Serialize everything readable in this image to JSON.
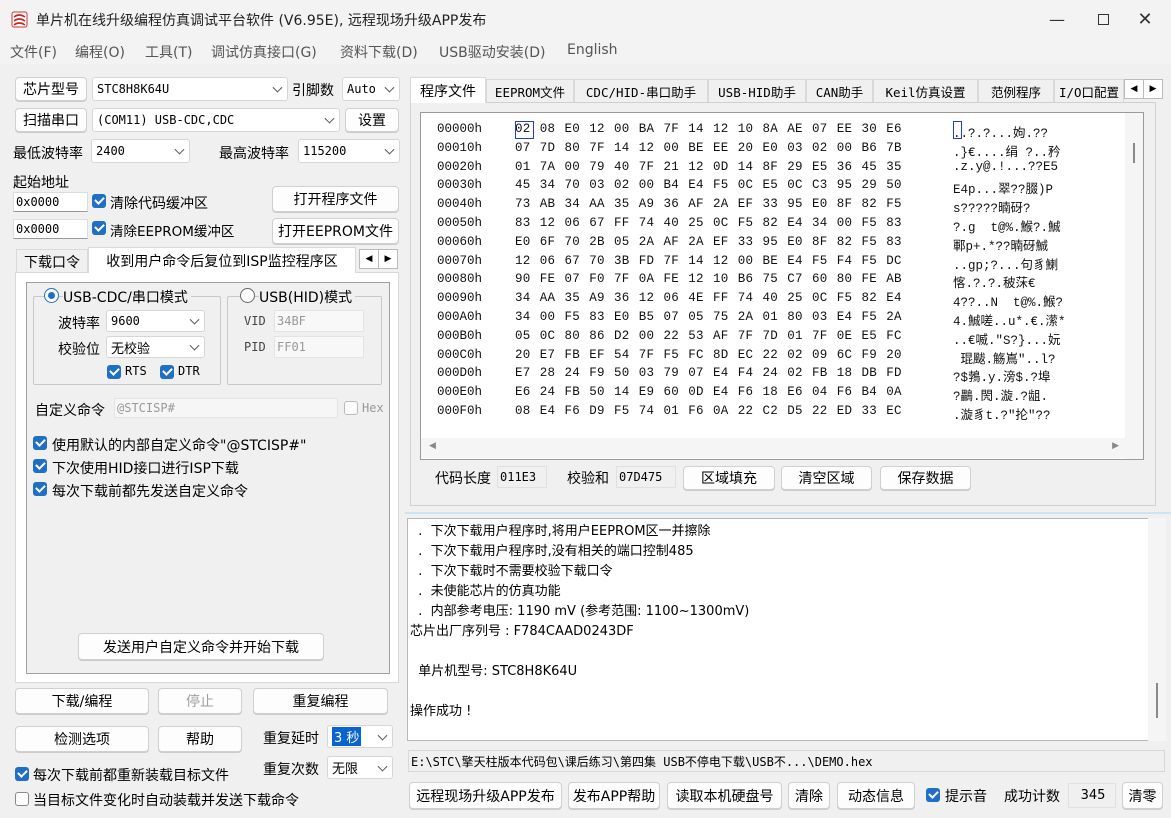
{
  "window": {
    "title": "单片机在线升级编程仿真调试平台软件 (V6.95E), 远程现场升级APP发布"
  },
  "menu": [
    "文件(F)",
    "编程(O)",
    "工具(T)",
    "调试仿真接口(G)",
    "资料下载(D)",
    "USB驱动安装(D)",
    "English"
  ],
  "left": {
    "chip_button": "芯片型号",
    "chip_value": "STC8H8K64U",
    "pins_label": "引脚数",
    "pins_value": "Auto",
    "scan_button": "扫描串口",
    "port_value": "(COM11) USB-CDC,CDC",
    "settings_button": "设置",
    "min_baud_label": "最低波特率",
    "min_baud_value": "2400",
    "max_baud_label": "最高波特率",
    "max_baud_value": "115200",
    "start_addr_label": "起始地址",
    "code_addr": "0x0000",
    "eeprom_addr": "0x0000",
    "clear_code_label": "清除代码缓冲区",
    "clear_eeprom_label": "清除EEPROM缓冲区",
    "open_program_button": "打开程序文件",
    "open_eeprom_button": "打开EEPROM文件",
    "tabs": [
      "下载口令",
      "收到用户命令后复位到ISP监控程序区"
    ],
    "mode_cdc": "USB-CDC/串口模式",
    "mode_hid": "USB(HID)模式",
    "baud_label": "波特率",
    "baud_value": "9600",
    "parity_label": "校验位",
    "parity_value": "无校验",
    "rts": "RTS",
    "dtr": "DTR",
    "vid_label": "VID",
    "vid_value": "34BF",
    "pid_label": "PID",
    "pid_value": "FF01",
    "custom_cmd_label": "自定义命令",
    "custom_cmd_placeholder": "@STCISP#",
    "hex_label": "Hex",
    "options": [
      "使用默认的内部自定义命令\"@STCISP#\"",
      "下次使用HID接口进行ISP下载",
      "每次下载前都先发送自定义命令"
    ],
    "send_button": "发送用户自定义命令并开始下载",
    "download_button": "下载/编程",
    "stop_button": "停止",
    "repeat_button": "重复编程",
    "detect_button": "检测选项",
    "help_button": "帮助",
    "repeat_delay_label": "重复延时",
    "repeat_delay_value": "3 秒",
    "repeat_count_label": "重复次数",
    "repeat_count_value": "无限",
    "reload_label": "每次下载前都重新装载目标文件",
    "auto_label": "当目标文件变化时自动装载并发送下载命令"
  },
  "right": {
    "tabs": [
      "程序文件",
      "EEPROM文件",
      "CDC/HID-串口助手",
      "USB-HID助手",
      "CAN助手",
      "Keil仿真设置",
      "范例程序",
      "I/O口配置"
    ],
    "hex_rows": [
      {
        "addr": "00000h",
        "bytes": "02 08 E0 12 00 BA 7F 14 12 10 8A AE 07 EE 30 E6",
        "ascii": "..?.?...姁.??"
      },
      {
        "addr": "00010h",
        "bytes": "07 7D 80 7F 14 12 00 BE EE 20 E0 03 02 00 B6 7B",
        "ascii": ".}€....绢 ?..矜"
      },
      {
        "addr": "00020h",
        "bytes": "01 7A 00 79 40 7F 21 12 0D 14 8F 29 E5 36 45 35",
        "ascii": ".z.y@.!...??E5"
      },
      {
        "addr": "00030h",
        "bytes": "45 34 70 03 02 00 B4 E4 F5 0C E5 0C C3 95 29 50",
        "ascii": "E4p...翠??腏)P"
      },
      {
        "addr": "00040h",
        "bytes": "73 AB 34 AA 35 A9 36 AF 2A EF 33 95 E0 8F 82 F5",
        "ascii": "s?????暔砑?"
      },
      {
        "addr": "00050h",
        "bytes": "83 12 06 67 FF 74 40 25 0C F5 82 E4 34 00 F5 83",
        "ascii": "?.g  t@%.鯸?.鯎"
      },
      {
        "addr": "00060h",
        "bytes": "E0 6F 70 2B 05 2A AF 2A EF 33 95 E0 8F 82 F5 83",
        "ascii": "鄆p+.*??暔砑鯎"
      },
      {
        "addr": "00070h",
        "bytes": "12 06 67 70 3B FD 7F 14 12 00 BE E4 F5 F4 F5 DC",
        "ascii": "..gp;?...句豸鯻"
      },
      {
        "addr": "00080h",
        "bytes": "90 FE 07 F0 7F 0A FE 12 10 B6 75 C7 60 80 FE AB",
        "ascii": "愘.?.?.秛莯€"
      },
      {
        "addr": "00090h",
        "bytes": "34 AA 35 A9 36 12 06 4E FF 74 40 25 0C F5 82 E4",
        "ascii": "4??..N  t@%.鯸?"
      },
      {
        "addr": "000A0h",
        "bytes": "34 00 F5 83 E0 B5 07 05 75 2A 01 80 03 E4 F5 2A",
        "ascii": "4.鯎嗟..u*.€.潆*"
      },
      {
        "addr": "000B0h",
        "bytes": "05 0C 80 86 D2 00 22 53 AF 7F 7D 01 7F 0E E5 FC",
        "ascii": "..€喴.\"S?}...妧"
      },
      {
        "addr": "000C0h",
        "bytes": "20 E7 FB EF 54 7F F5 FC 8D EC 22 02 09 6C F9 20",
        "ascii": " 琨颰.觞嶌\"..l?"
      },
      {
        "addr": "000D0h",
        "bytes": "E7 28 24 F9 50 03 79 07 E4 F4 24 02 FB 18 DB FD",
        "ascii": "?$鵓.y.滂$.?埠"
      },
      {
        "addr": "000E0h",
        "bytes": "E6 24 FB 50 14 E9 60 0D E4 F6 18 E6 04 F6 B4 0A",
        "ascii": "?鸓.閌.漩.?龃."
      },
      {
        "addr": "000F0h",
        "bytes": "08 E4 F6 D9 F5 74 01 F6 0A 22 C2 D5 22 ED 33 EC",
        "ascii": ".漩豸t.?\"抡\"??"
      }
    ],
    "code_len_label": "代码长度",
    "code_len_value": "011E3",
    "checksum_label": "校验和",
    "checksum_value": "07D475",
    "fill_button": "区域填充",
    "clear_button": "清空区域",
    "save_button": "保存数据",
    "log": [
      "  .  下次下载用户程序时,将用户EEPROM区一并擦除",
      "  .  下次下载用户程序时,没有相关的端口控制485",
      "  .  下次下载时不需要校验下载口令",
      "  .  未使能芯片的仿真功能",
      "  .  内部参考电压: 1190 mV (参考范围: 1100~1300mV)",
      "芯片出厂序列号 : F784CAAD0243DF",
      "",
      "  单片机型号: STC8H8K64U",
      "",
      "操作成功 !"
    ],
    "path": "E:\\STC\\擎天柱版本代码包\\课后练习\\第四集 USB不停电下载\\USB不...\\DEMO.hex",
    "publish_button": "远程现场升级APP发布",
    "publish_help_button": "发布APP帮助",
    "read_disk_button": "读取本机硬盘号",
    "clear_log_button": "清除",
    "dynamic_button": "动态信息",
    "sound_label": "提示音",
    "success_label": "成功计数",
    "success_value": "345",
    "reset_button": "清零"
  }
}
